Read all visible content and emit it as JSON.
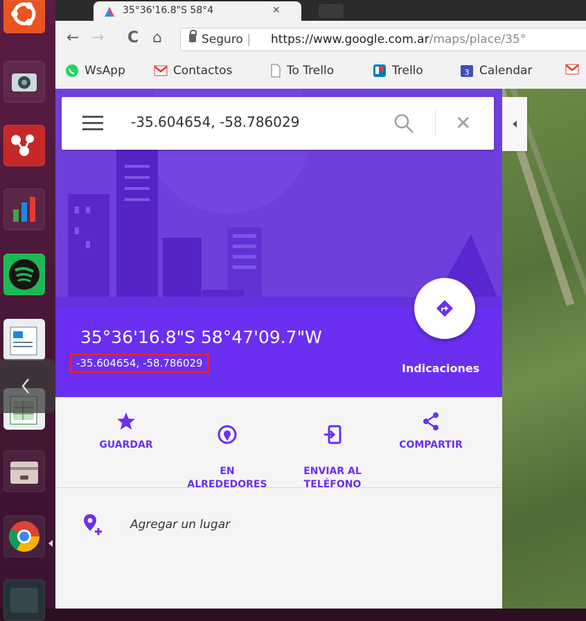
{
  "browser": {
    "tab_title": "35°36'16.8\"S 58°4",
    "nav": {
      "back": "←",
      "forward": "→",
      "reload": "C",
      "home": "⌂"
    },
    "omnibox": {
      "secure_label": "Seguro",
      "separator": "|",
      "url_scheme": "https://",
      "url_host": "www.google.com.ar",
      "url_path": "/maps/place/35°"
    },
    "bookmarks": [
      {
        "label": "WsApp",
        "icon": "whatsapp-icon",
        "color": "#25d366"
      },
      {
        "label": "Contactos",
        "icon": "gmail-icon",
        "color": "#e53935"
      },
      {
        "label": "To Trello",
        "icon": "page-icon",
        "color": "#9e9e9e"
      },
      {
        "label": "Trello",
        "icon": "trello-icon",
        "color": "#0079bf"
      },
      {
        "label": "Calendar",
        "icon": "calendar-icon",
        "color": "#3f51b5"
      }
    ]
  },
  "maps": {
    "search_value": "-35.604654, -58.786029",
    "place_title": "35°36'16.8\"S 58°47'09.7\"W",
    "coords_decimal": "-35.604654, -58.786029",
    "directions_label": "Indicaciones",
    "actions": [
      {
        "label": "GUARDAR",
        "icon": "star-icon"
      },
      {
        "label": "EN\nALREDEDORES",
        "icon": "nearby-icon"
      },
      {
        "label": "ENVIAR AL\nTELÉFONO",
        "icon": "send-to-phone-icon"
      },
      {
        "label": "COMPARTIR",
        "icon": "share-icon"
      }
    ],
    "add_place_label": "Agregar un lugar",
    "accent_color": "#6a2ff0",
    "highlight_color": "#e2242e"
  }
}
